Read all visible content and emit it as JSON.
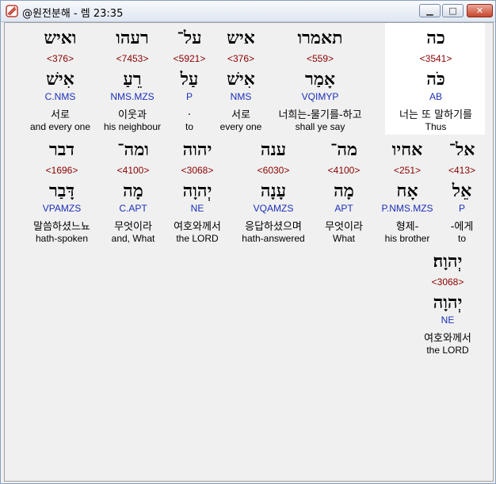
{
  "window": {
    "title": "@원전분해 - 렘 23:35"
  },
  "controls": {
    "minimize": "▁",
    "maximize": "□",
    "close": "✕"
  },
  "rows": [
    [
      {
        "hebrew": "כה",
        "strong": "<3541>",
        "lemma": "כֹּה",
        "morph": "AB",
        "korean": "너는 또 말하기를",
        "english": "Thus"
      },
      {
        "hebrew": "תאמרו",
        "strong": "<559>",
        "lemma": "אָמַר",
        "morph": "VQIMYP",
        "korean": "너희는-물기를-하고",
        "english": "shall ye say"
      },
      {
        "hebrew": "איש",
        "strong": "<376>",
        "lemma": "אִישׁ",
        "morph": "NMS",
        "korean": "서로",
        "english": "every one"
      },
      {
        "hebrew": "על־",
        "strong": "<5921>",
        "lemma": "עַל",
        "morph": "P",
        "korean": ".",
        "english": "to"
      },
      {
        "hebrew": "רעהו",
        "strong": "<7453>",
        "lemma": "רֵעַ",
        "morph": "NMS.MZS",
        "korean": "이웃과",
        "english": "his neighbour"
      },
      {
        "hebrew": "ואיש",
        "strong": "<376>",
        "lemma": "אִישׁ",
        "morph": "C.NMS",
        "korean": "서로",
        "english": "and every one"
      }
    ],
    [
      {
        "hebrew": "אל־",
        "strong": "<413>",
        "lemma": "אֵל",
        "morph": "P",
        "korean": "-에게",
        "english": "to"
      },
      {
        "hebrew": "אחיו",
        "strong": "<251>",
        "lemma": "אָח",
        "morph": "P.NMS.MZS",
        "korean": "형제-",
        "english": "his brother"
      },
      {
        "hebrew": "מה־",
        "strong": "<4100>",
        "lemma": "מָה",
        "morph": "APT",
        "korean": "무엇이라",
        "english": "What"
      },
      {
        "hebrew": "ענה",
        "strong": "<6030>",
        "lemma": "עָנָה",
        "morph": "VQAMZS",
        "korean": "응답하셨으며",
        "english": "hath-answered"
      },
      {
        "hebrew": "יהוה",
        "strong": "<3068>",
        "lemma": "יְהוָה",
        "morph": "NE",
        "korean": "여호와께서",
        "english": "the LORD"
      },
      {
        "hebrew": "ומה־",
        "strong": "<4100>",
        "lemma": "מָה",
        "morph": "C.APT",
        "korean": "무엇이라",
        "english": "and, What"
      },
      {
        "hebrew": "דבר",
        "strong": "<1696>",
        "lemma": "דָּבַר",
        "morph": "VPAMZS",
        "korean": "말씀하셨느뇨",
        "english": "hath-spoken"
      }
    ],
    [
      {
        "hebrew": "יְהוָה׃",
        "strong": "<3068>",
        "lemma": "יְהוָה",
        "morph": "NE",
        "korean": "여호와께서",
        "english": "the LORD"
      }
    ]
  ]
}
